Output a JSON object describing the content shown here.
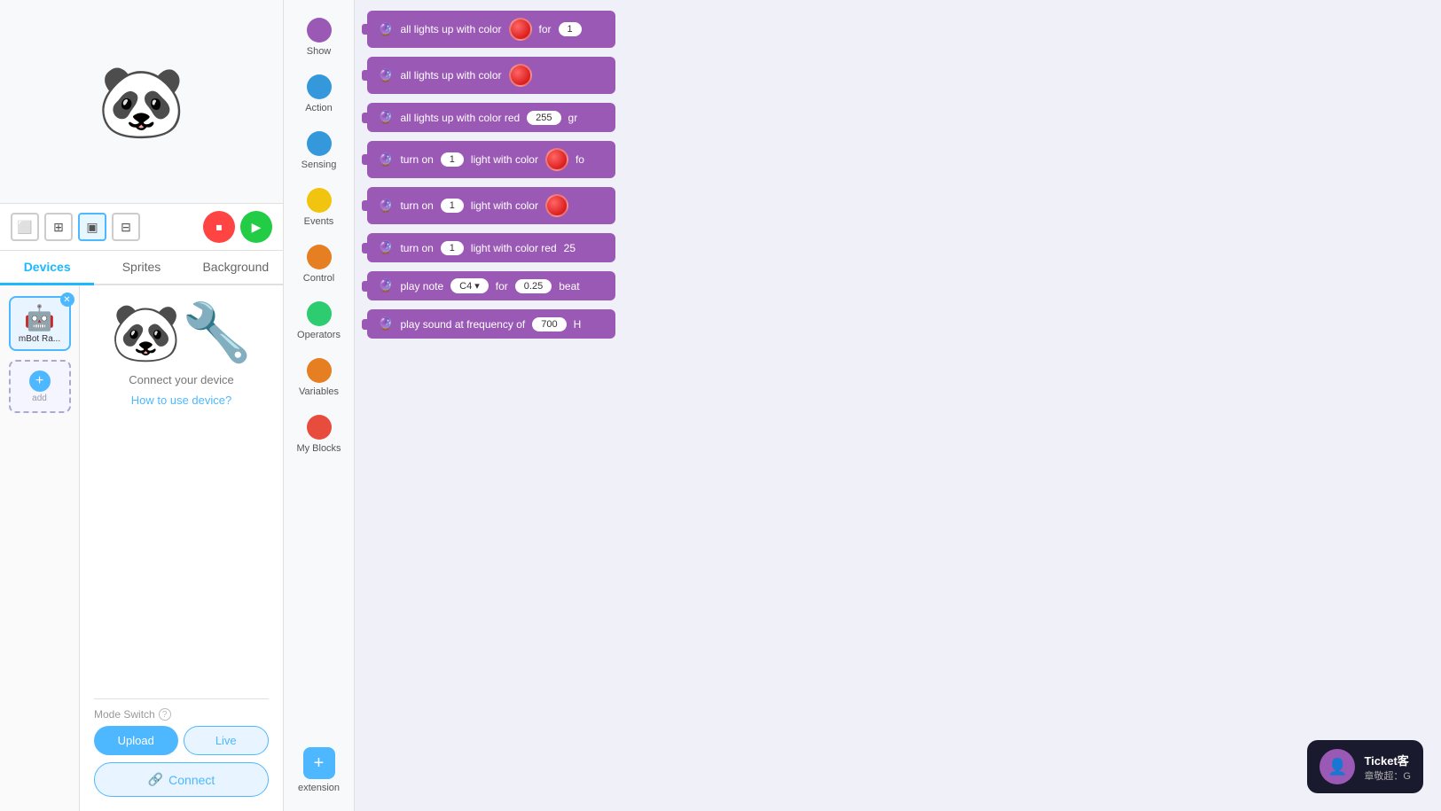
{
  "leftPanel": {
    "tabs": [
      {
        "label": "Devices",
        "active": true
      },
      {
        "label": "Sprites",
        "active": false
      },
      {
        "label": "Background",
        "active": false
      }
    ],
    "device": {
      "name": "mBot Ra...",
      "connectLabel": "Connect your device",
      "howToLabel": "How to use device?",
      "modeSwitch": "Mode Switch",
      "uploadBtn": "Upload",
      "liveBtn": "Live",
      "connectBtn": "Connect"
    },
    "addLabel": "add"
  },
  "categories": [
    {
      "id": "show",
      "label": "Show",
      "color": "#9b59b6"
    },
    {
      "id": "action",
      "label": "Action",
      "color": "#3498db"
    },
    {
      "id": "sensing",
      "label": "Sensing",
      "color": "#3498db"
    },
    {
      "id": "events",
      "label": "Events",
      "color": "#f1c40f"
    },
    {
      "id": "control",
      "label": "Control",
      "color": "#e67e22"
    },
    {
      "id": "operators",
      "label": "Operators",
      "color": "#2ecc71"
    },
    {
      "id": "variables",
      "label": "Variables",
      "color": "#e67e22"
    },
    {
      "id": "my_blocks",
      "label": "My Blocks",
      "color": "#e74c3c"
    }
  ],
  "extensionLabel": "extension",
  "blocks": [
    {
      "id": "b1",
      "text": "all lights up with color",
      "hasColor": true,
      "suffix": "for",
      "oval": "1",
      "ovalWhite": true
    },
    {
      "id": "b2",
      "text": "all lights up with color",
      "hasColor": true,
      "suffix": "",
      "oval": "",
      "ovalWhite": false
    },
    {
      "id": "b3",
      "text": "all lights up with color red",
      "hasColor": false,
      "suffix": "gr",
      "oval": "255",
      "ovalWhite": true
    },
    {
      "id": "b4",
      "text": "turn on",
      "numOval": "1",
      "textMid": "light with color",
      "hasColor": true,
      "suffix": "fo",
      "oval": "",
      "ovalWhite": false
    },
    {
      "id": "b5",
      "text": "turn on",
      "numOval": "1",
      "textMid": "light with color",
      "hasColor": true,
      "suffix": "",
      "oval": "",
      "ovalWhite": false
    },
    {
      "id": "b6",
      "text": "turn on",
      "numOval": "1",
      "textMid": "light with color red",
      "hasColor": false,
      "suffix": "25",
      "oval": "",
      "ovalWhite": false
    },
    {
      "id": "b7",
      "text": "play note",
      "noteOval": "C4 ▾",
      "forLabel": "for",
      "beatOval": "0.25",
      "beatLabel": "beat"
    },
    {
      "id": "b8",
      "text": "play sound at frequency of",
      "freqOval": "700",
      "suffix": "H"
    }
  ],
  "chat": {
    "avatar": "👤",
    "title": "Ticket客",
    "subtitle": "章敬超：G"
  }
}
